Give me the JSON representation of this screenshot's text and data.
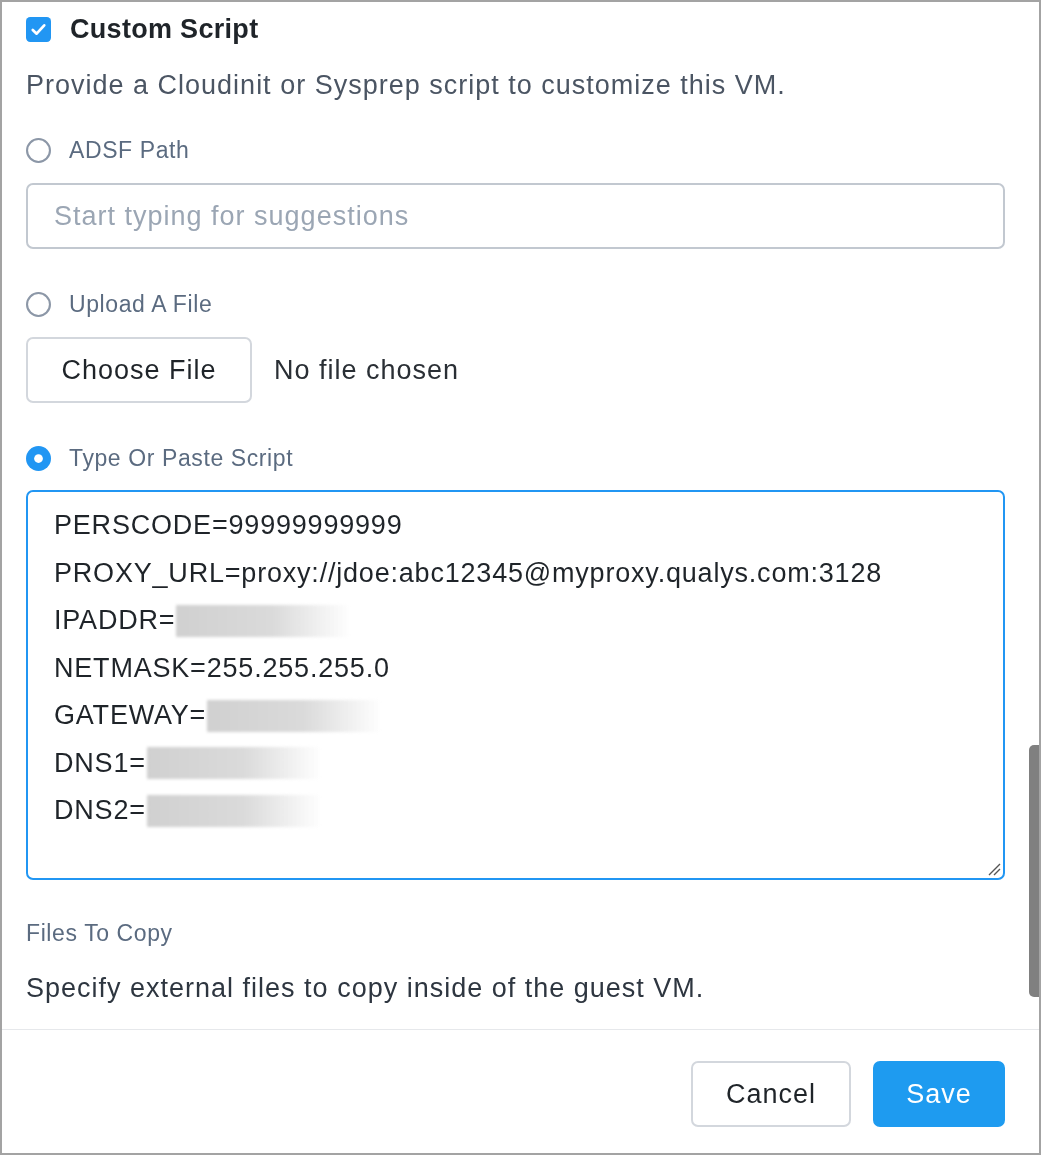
{
  "custom_script": {
    "label": "Custom Script",
    "checked": true,
    "description": "Provide a Cloudinit or Sysprep script to customize this VM."
  },
  "source_options": [
    {
      "kind": "path",
      "label": "ADSF Path",
      "selected": false,
      "placeholder": "Start typing for suggestions"
    },
    {
      "kind": "upload",
      "label": "Upload A File",
      "selected": false,
      "button": "Choose File",
      "status": "No file chosen"
    },
    {
      "kind": "script",
      "label": "Type Or Paste Script",
      "selected": true,
      "lines": [
        {
          "text": "PERSCODE=99999999999",
          "redacted": false
        },
        {
          "text": "PROXY_URL=proxy://jdoe:abc12345@myproxy.qualys.com:3128",
          "redacted": false
        },
        {
          "text": "IPADDR=",
          "redacted": true
        },
        {
          "text": "NETMASK=255.255.255.0",
          "redacted": false
        },
        {
          "text": "GATEWAY=",
          "redacted": true
        },
        {
          "text": "DNS1=",
          "redacted": true
        },
        {
          "text": "DNS2=",
          "redacted": true
        }
      ]
    }
  ],
  "files_to_copy": {
    "label": "Files To Copy",
    "description": "Specify external files to copy inside of the guest VM."
  },
  "buttons": [
    {
      "kind": "secondary",
      "label": "Cancel"
    },
    {
      "kind": "primary",
      "label": "Save"
    }
  ]
}
